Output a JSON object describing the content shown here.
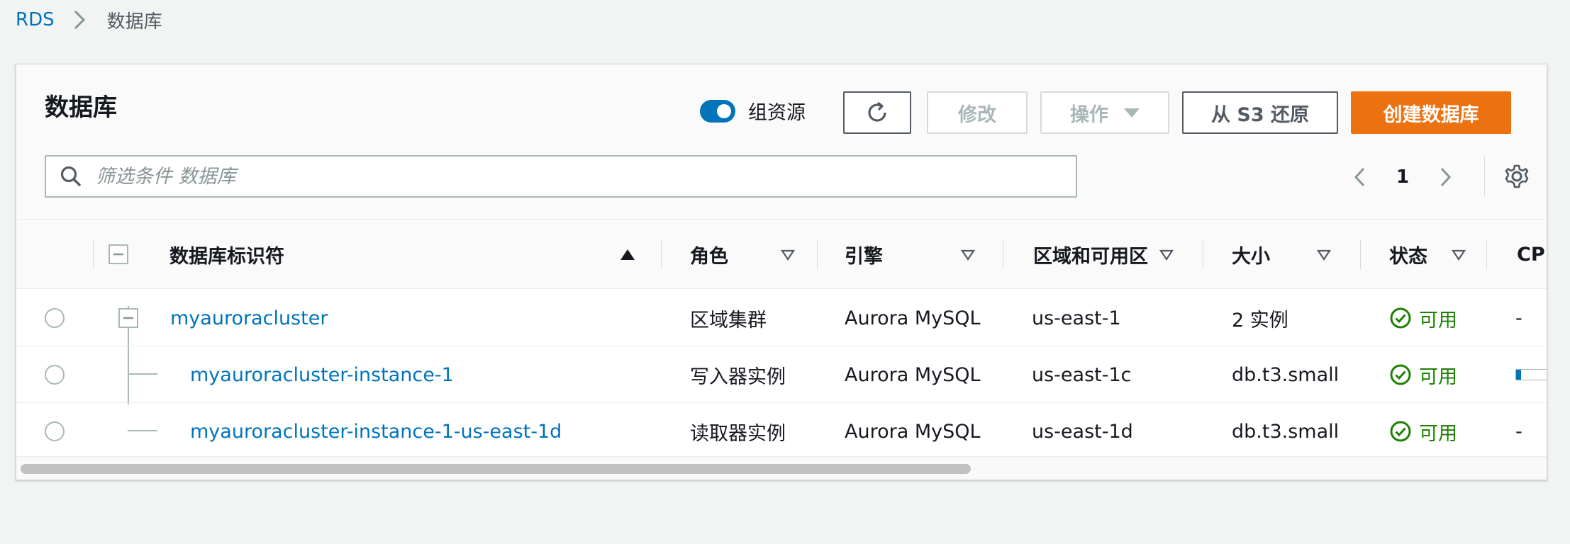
{
  "breadcrumb": {
    "root": "RDS",
    "current": "数据库"
  },
  "panel": {
    "title": "数据库",
    "group_toggle_label": "组资源",
    "group_toggle_on": true,
    "buttons": {
      "refresh_icon": "refresh-icon",
      "modify": "修改",
      "actions": "操作",
      "restore": "从 S3 还原",
      "create": "创建数据库"
    },
    "search": {
      "placeholder": "筛选条件 数据库",
      "value": ""
    },
    "pagination": {
      "current_page": "1"
    }
  },
  "table": {
    "headers": {
      "identifier": "数据库标识符",
      "role": "角色",
      "engine": "引擎",
      "region": "区域和可用区",
      "size": "大小",
      "status": "状态",
      "cpu": "CPU"
    },
    "rows": [
      {
        "identifier": "myauroracluster",
        "role": "区域集群",
        "engine": "Aurora MySQL",
        "region": "us-east-1",
        "size": "2 实例",
        "status": "可用",
        "cpu": "-"
      },
      {
        "identifier": "myauroracluster-instance-1",
        "role": "写入器实例",
        "engine": "Aurora MySQL",
        "region": "us-east-1c",
        "size": "db.t3.small",
        "status": "可用",
        "cpu_fraction": 0.15
      },
      {
        "identifier": "myauroracluster-instance-1-us-east-1d",
        "role": "读取器实例",
        "engine": "Aurora MySQL",
        "region": "us-east-1d",
        "size": "db.t3.small",
        "status": "可用",
        "cpu": "-"
      }
    ]
  },
  "colors": {
    "link": "#0073bb",
    "primary_button": "#ec7211",
    "status_ok": "#1d8102"
  }
}
